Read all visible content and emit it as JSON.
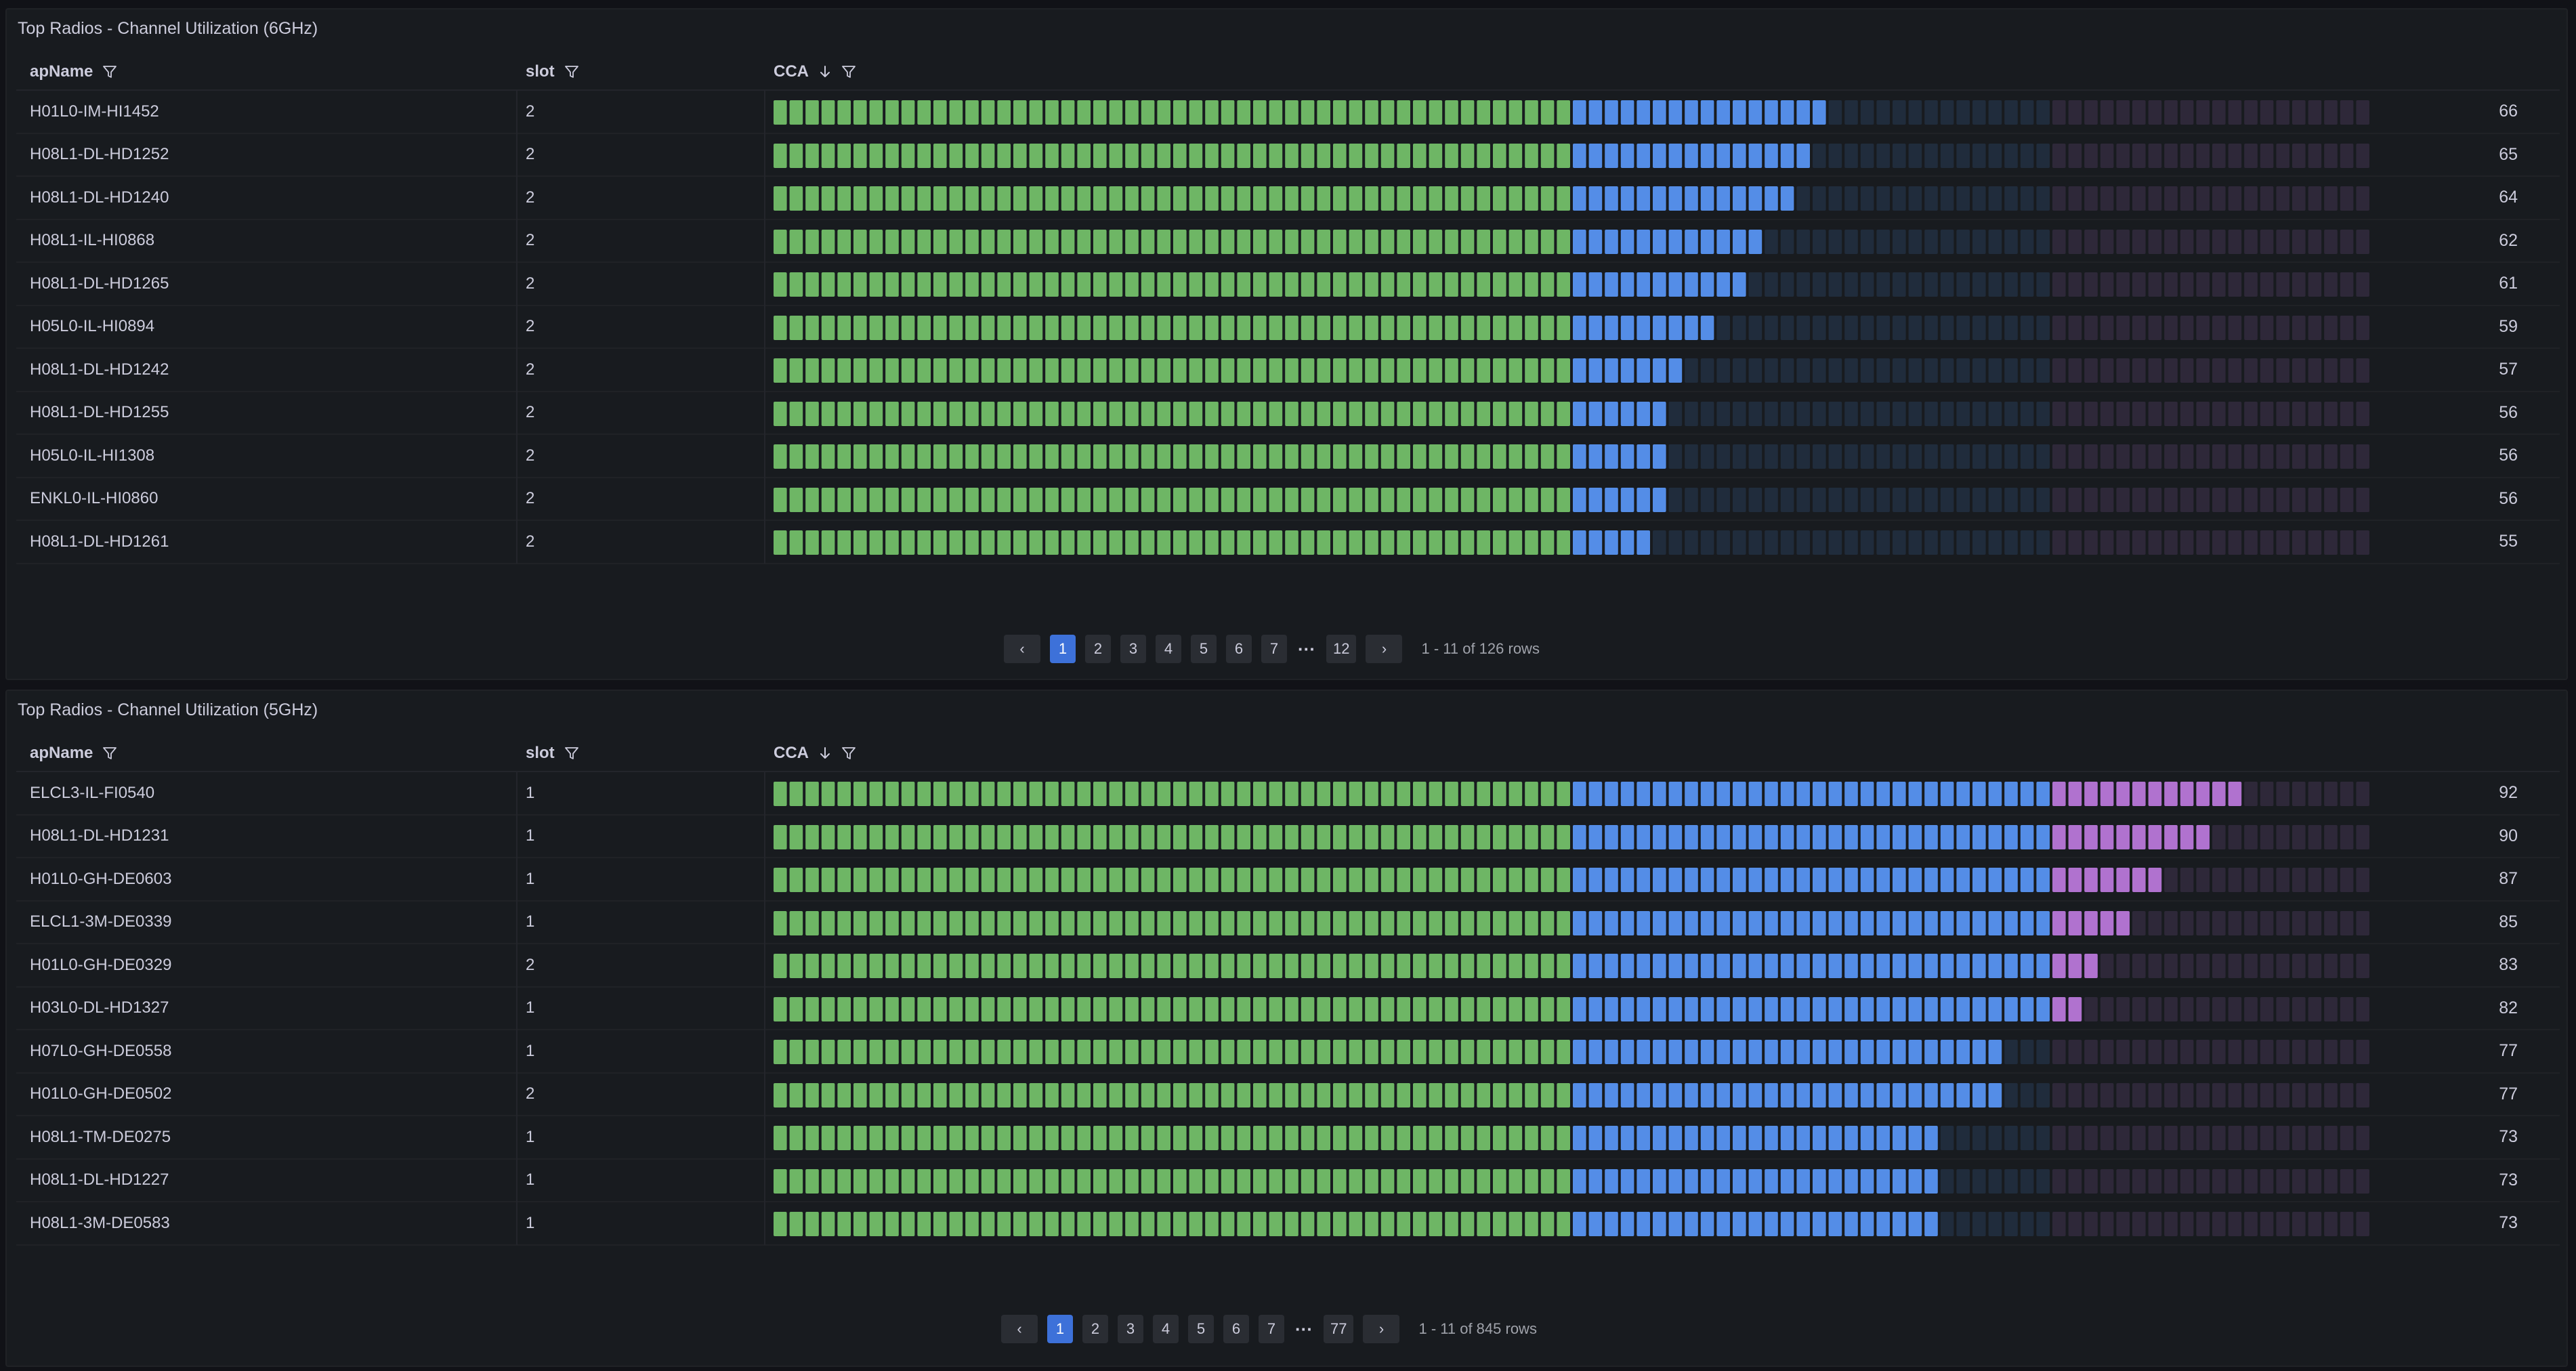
{
  "colors": {
    "green": "#73bf69",
    "blue": "#5794f2",
    "purple": "#b877d9",
    "accent": "#3d71d9"
  },
  "gauge_thresholds": {
    "green_end": 50,
    "blue_end": 80,
    "max": 100
  },
  "panels": [
    {
      "title": "Top Radios - Channel Utilization (6GHz)",
      "columns": {
        "apName": "apName",
        "slot": "slot",
        "cca": "CCA"
      },
      "rows": [
        {
          "apName": "H01L0-IM-HI1452",
          "slot": "2",
          "cca": 66
        },
        {
          "apName": "H08L1-DL-HD1252",
          "slot": "2",
          "cca": 65
        },
        {
          "apName": "H08L1-DL-HD1240",
          "slot": "2",
          "cca": 64
        },
        {
          "apName": "H08L1-IL-HI0868",
          "slot": "2",
          "cca": 62
        },
        {
          "apName": "H08L1-DL-HD1265",
          "slot": "2",
          "cca": 61
        },
        {
          "apName": "H05L0-IL-HI0894",
          "slot": "2",
          "cca": 59
        },
        {
          "apName": "H08L1-DL-HD1242",
          "slot": "2",
          "cca": 57
        },
        {
          "apName": "H08L1-DL-HD1255",
          "slot": "2",
          "cca": 56
        },
        {
          "apName": "H05L0-IL-HI1308",
          "slot": "2",
          "cca": 56
        },
        {
          "apName": "ENKL0-IL-HI0860",
          "slot": "2",
          "cca": 56
        },
        {
          "apName": "H08L1-DL-HD1261",
          "slot": "2",
          "cca": 55
        }
      ],
      "pagination": {
        "prev": "‹",
        "pages": [
          "1",
          "2",
          "3",
          "4",
          "5",
          "6",
          "7"
        ],
        "ellipsis": "···",
        "last": "12",
        "next": "›",
        "current": "1",
        "info": "1 - 11 of 126 rows"
      }
    },
    {
      "title": "Top Radios - Channel Utilization (5GHz)",
      "columns": {
        "apName": "apName",
        "slot": "slot",
        "cca": "CCA"
      },
      "rows": [
        {
          "apName": "ELCL3-IL-FI0540",
          "slot": "1",
          "cca": 92
        },
        {
          "apName": "H08L1-DL-HD1231",
          "slot": "1",
          "cca": 90
        },
        {
          "apName": "H01L0-GH-DE0603",
          "slot": "1",
          "cca": 87
        },
        {
          "apName": "ELCL1-3M-DE0339",
          "slot": "1",
          "cca": 85
        },
        {
          "apName": "H01L0-GH-DE0329",
          "slot": "2",
          "cca": 83
        },
        {
          "apName": "H03L0-DL-HD1327",
          "slot": "1",
          "cca": 82
        },
        {
          "apName": "H07L0-GH-DE0558",
          "slot": "1",
          "cca": 77
        },
        {
          "apName": "H01L0-GH-DE0502",
          "slot": "2",
          "cca": 77
        },
        {
          "apName": "H08L1-TM-DE0275",
          "slot": "1",
          "cca": 73
        },
        {
          "apName": "H08L1-DL-HD1227",
          "slot": "1",
          "cca": 73
        },
        {
          "apName": "H08L1-3M-DE0583",
          "slot": "1",
          "cca": 73
        }
      ],
      "pagination": {
        "prev": "‹",
        "pages": [
          "1",
          "2",
          "3",
          "4",
          "5",
          "6",
          "7"
        ],
        "ellipsis": "···",
        "last": "77",
        "next": "›",
        "current": "1",
        "info": "1 - 11 of 845 rows"
      }
    }
  ]
}
